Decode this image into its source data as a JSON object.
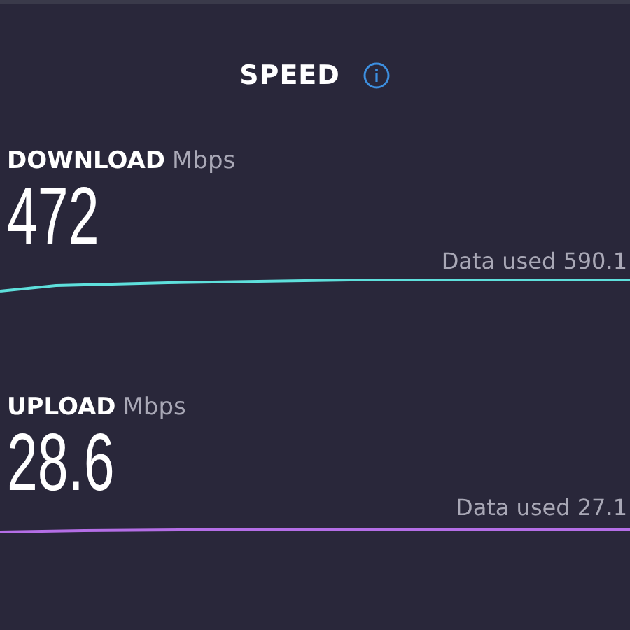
{
  "title": "SPEED",
  "tests": [
    {
      "name": "DOWNLOAD",
      "unit": "Mbps",
      "value": "472",
      "data_used": "Data used 590.1",
      "color": "#5ee0dc"
    },
    {
      "name": "UPLOAD",
      "unit": "Mbps",
      "value": "28.6",
      "data_used": "Data used 27.1",
      "color": "#b46ee6"
    }
  ]
}
